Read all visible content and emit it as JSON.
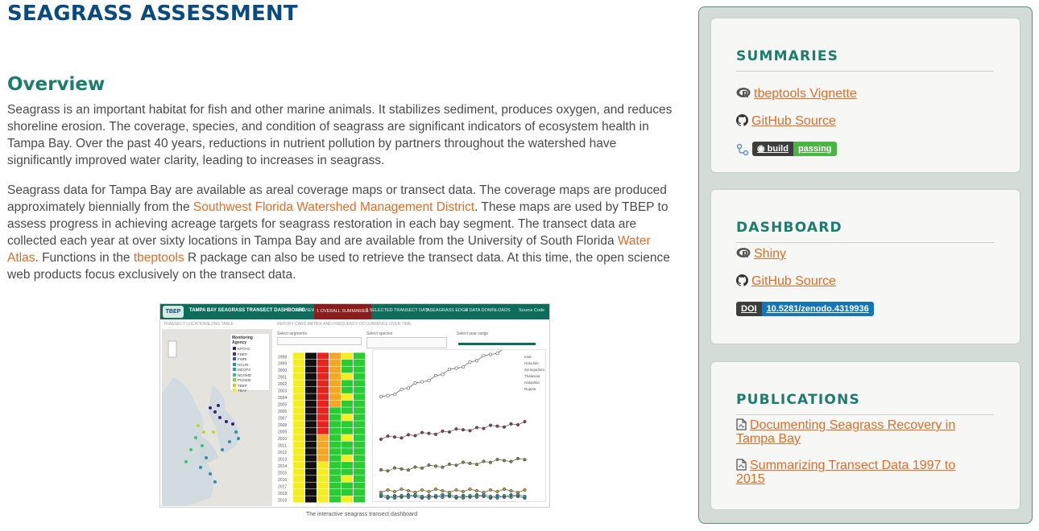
{
  "page": {
    "title": "SEAGRASS ASSESSMENT",
    "section_title": "Overview",
    "para1": "Seagrass is an important habitat for fish and other marine animals. It stabilizes sediment, produces oxygen, and reduces shoreline erosion. The coverage, species, and condition of seagrass are significant indicators of ecosystem health in Tampa Bay. Over the past 40 years, reductions in nutrient pollution by partners throughout the watershed have significantly improved water clarity, leading to increases in seagrass.",
    "para2": {
      "t1": "Seagrass data for Tampa Bay are available as areal coverage maps or transect data. The coverage maps are produced approximately biennially from the ",
      "link1": "Southwest Florida Watershed Management District",
      "t2": ". These maps are used by TBEP to assess progress in achieving acreage targets for seagrass restoration in each bay segment. The transect data are collected each year at over sixty locations in Tampa Bay and are available from the University of South Florida ",
      "link2": "Water Atlas",
      "t3": ". Functions in the ",
      "link3": "tbeptools",
      "t4": " R package can also be used to retrieve the transect data. At this time, the open science web products focus exclusively on the transect data."
    },
    "caption": "The interactive seagrass transect dashboard"
  },
  "dashboard_thumb": {
    "logo": "TBEP",
    "brand": "TAMPA BAY SEAGRASS TRANSECT DASHBOARD",
    "tabs": [
      "OVERVIEW",
      "1 OVERALL SUMMARIES",
      "2 SELECTED TRANSECT DATA",
      "3 SEAGRASS EDGE",
      "4 DATA DOWNLOADS",
      "Source Code"
    ],
    "subtabs": [
      "TRANSECT LOCATIONS",
      "LONG TABLE",
      "REPORT CARD MATRIX AND FREQUENCY OCCURRENCE OVER TIME"
    ],
    "selectors": [
      "Select segments",
      "Select species",
      "Select year range"
    ],
    "legend_title": "Monitoring Agency",
    "legend_items": [
      "EPCHC",
      "FDEP",
      "FWRI",
      "HCLRI",
      "MCOFS",
      "NCOMD",
      "PCDEM",
      "TBEP",
      "TBAY"
    ],
    "years": [
      "1998",
      "1999",
      "2000",
      "2001",
      "2002",
      "2003",
      "2004",
      "2005",
      "2006",
      "2007",
      "2008",
      "2009",
      "2010",
      "2011",
      "2012",
      "2013",
      "2014",
      "2015",
      "2016",
      "2017",
      "2018",
      "2019"
    ],
    "species": [
      "total",
      "Halodule",
      "Syringodium",
      "Thalassia",
      "Halophila",
      "Ruppia"
    ],
    "colors": {
      "green": "#29cc33",
      "yellow": "#f2ee22",
      "orange": "#f5a623",
      "red": "#e8221c",
      "black": "#111111"
    }
  },
  "sidebar": {
    "summaries": {
      "title": "SUMMARIES",
      "links": [
        {
          "icon": "r-logo-icon",
          "label": "tbeptools Vignette"
        },
        {
          "icon": "github-icon",
          "label": "GitHub Source"
        }
      ],
      "badge": {
        "left": "build",
        "right": "passing",
        "right_color": "#4bb543"
      }
    },
    "dashboard": {
      "title": "DASHBOARD",
      "links": [
        {
          "icon": "r-logo-icon",
          "label": "Shiny"
        },
        {
          "icon": "github-icon",
          "label": "GitHub Source"
        }
      ],
      "badge": {
        "left": "DOI",
        "right": "10.5281/zenodo.4319936",
        "right_color": "#1475b7"
      }
    },
    "publications": {
      "title": "PUBLICATIONS",
      "links": [
        {
          "icon": "pdf-icon",
          "label": "Documenting Seagrass Recovery in Tampa Bay"
        },
        {
          "icon": "pdf-icon",
          "label": "Summarizing Transect Data 1997 to 2015"
        }
      ]
    }
  }
}
